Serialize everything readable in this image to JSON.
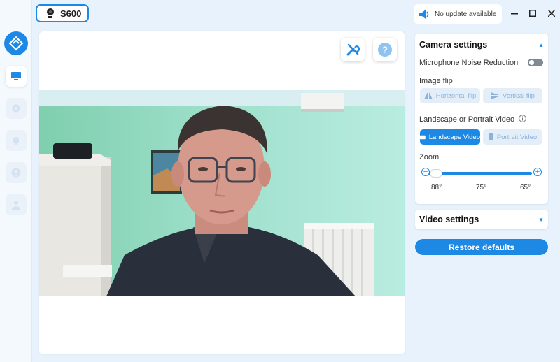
{
  "device": {
    "name": "S600",
    "icon": "webcam-icon"
  },
  "update": {
    "text": "No update available",
    "icon": "speaker-icon"
  },
  "sidebar": {
    "items": [
      {
        "name": "logo",
        "icon": "app-logo-icon"
      },
      {
        "name": "camera",
        "icon": "monitor-icon",
        "active": true
      },
      {
        "name": "settings",
        "icon": "gear-icon"
      },
      {
        "name": "notifications",
        "icon": "bell-icon"
      },
      {
        "name": "info",
        "icon": "info-icon"
      },
      {
        "name": "account",
        "icon": "user-icon"
      }
    ]
  },
  "toolbar": {
    "tools_icon": "tools-icon",
    "help_icon": "help-icon"
  },
  "camera_settings": {
    "title": "Camera settings",
    "noise_reduction": {
      "label": "Microphone Noise Reduction",
      "enabled": false
    },
    "image_flip": {
      "label": "Image flip",
      "horizontal": "Horizontal flip",
      "vertical": "Vertical flip"
    },
    "orientation": {
      "label": "Landscape or Portrait Video",
      "landscape": "Landscape Video",
      "portrait": "Portrait Video",
      "selected": "landscape"
    },
    "zoom": {
      "label": "Zoom",
      "ticks": [
        "88°",
        "75°",
        "65°"
      ],
      "value": "88°"
    }
  },
  "video_settings": {
    "title": "Video settings"
  },
  "restore_label": "Restore defaults",
  "colors": {
    "accent": "#1e88e5",
    "background": "#e7f2fd"
  }
}
